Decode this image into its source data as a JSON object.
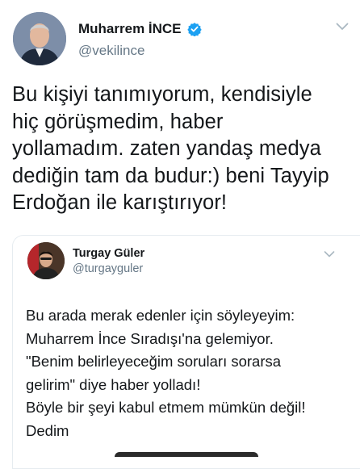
{
  "author": {
    "display_name": "Muharrem İNCE",
    "handle": "@vekilince",
    "verified": true,
    "avatar_icon": "profile-photo"
  },
  "tweet": {
    "lines": [
      "Bu kişiyi tanımıyorum, kendisiyle",
      "hiç görüşmedim, haber",
      "yollamadım. zaten yandaş medya",
      "dediğin tam da budur:) beni Tayyip",
      "Erdoğan ile karıştırıyor!"
    ]
  },
  "quoted": {
    "display_name": "Turgay Güler",
    "handle": "@turgayguler",
    "lines": [
      "Bu arada merak edenler için söyleyeyim:",
      "Muharrem İnce Sıradışı'na gelemiyor.",
      "\"Benim belirleyeceğim soruları sorarsa",
      "gelirim\" diye haber yolladı!",
      "Böyle bir şeyi kabul etmem mümkün değil!",
      "Dedim"
    ]
  },
  "colors": {
    "verified_badge": "#1da1f2",
    "secondary_text": "#657786",
    "primary_text": "#14171a",
    "card_border": "#e6ecf0"
  }
}
